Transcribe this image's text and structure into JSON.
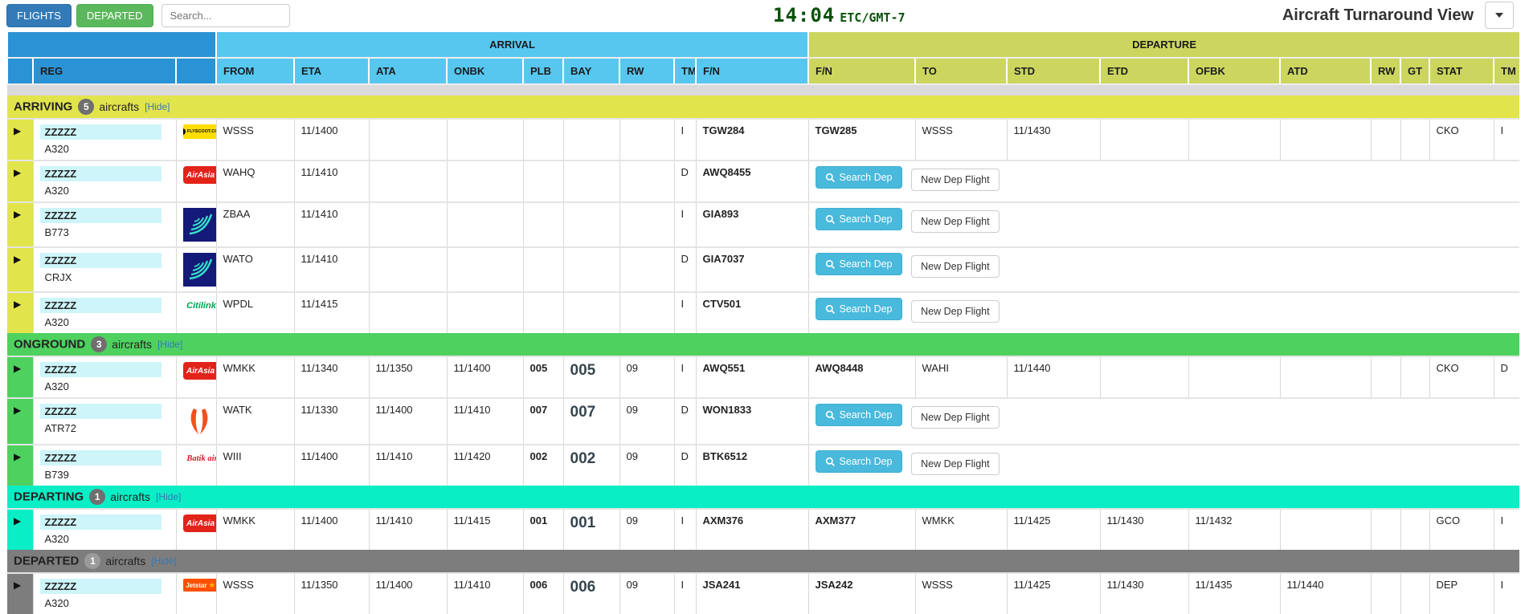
{
  "toolbar": {
    "flights_label": "FLIGHTS",
    "departed_label": "DEPARTED",
    "search_placeholder": "Search...",
    "clock_time": "14:04",
    "clock_tz": "ETC/GMT-7",
    "title": "Aircraft Turnaround View"
  },
  "table": {
    "group_arrival": "ARRIVAL",
    "group_departure": "DEPARTURE",
    "reg_col": "REG",
    "arr_cols": [
      "FROM",
      "ETA",
      "ATA",
      "ONBK",
      "PLB",
      "BAY",
      "RW",
      "TM",
      "F/N"
    ],
    "dep_cols": [
      "F/N",
      "TO",
      "STD",
      "ETD",
      "OFBK",
      "ATD",
      "RW",
      "GT",
      "STAT",
      "TM"
    ]
  },
  "buttons": {
    "search_dep": "Search Dep",
    "new_dep_flight": "New Dep Flight"
  },
  "logos": {
    "flyscoot": "FLYSCOOT.COM",
    "airasia": "AirAsia",
    "citilink": "Citilink",
    "batik": "Batik air",
    "jetstar": "Jetstar"
  },
  "sections": [
    {
      "name": "ARRIVING",
      "count": "5",
      "suffix": "aircrafts",
      "hide": "[Hide]",
      "rows": [
        {
          "reg": "ZZZZZ",
          "type": "A320",
          "from": "WSSS",
          "eta": "11/1400",
          "ata": "",
          "onbk": "",
          "plb": "",
          "bay": "",
          "rw": "",
          "tm": "I",
          "fn": "TGW284",
          "dep": {
            "fn": "TGW285",
            "to": "WSSS",
            "std": "11/1430",
            "etd": "",
            "ofbk": "",
            "atd": "",
            "rw": "",
            "gt": "",
            "stat": "CKO",
            "tm": "I"
          }
        },
        {
          "reg": "ZZZZZ",
          "type": "A320",
          "from": "WAHQ",
          "eta": "11/1410",
          "ata": "",
          "onbk": "",
          "plb": "",
          "bay": "",
          "rw": "",
          "tm": "D",
          "fn": "AWQ8455"
        },
        {
          "reg": "ZZZZZ",
          "type": "B773",
          "from": "ZBAA",
          "eta": "11/1410",
          "ata": "",
          "onbk": "",
          "plb": "",
          "bay": "",
          "rw": "",
          "tm": "I",
          "fn": "GIA893"
        },
        {
          "reg": "ZZZZZ",
          "type": "CRJX",
          "from": "WATO",
          "eta": "11/1410",
          "ata": "",
          "onbk": "",
          "plb": "",
          "bay": "",
          "rw": "",
          "tm": "D",
          "fn": "GIA7037"
        },
        {
          "reg": "ZZZZZ",
          "type": "A320",
          "from": "WPDL",
          "eta": "11/1415",
          "ata": "",
          "onbk": "",
          "plb": "",
          "bay": "",
          "rw": "",
          "tm": "I",
          "fn": "CTV501"
        }
      ]
    },
    {
      "name": "ONGROUND",
      "count": "3",
      "suffix": "aircrafts",
      "hide": "[Hide]",
      "rows": [
        {
          "reg": "ZZZZZ",
          "type": "A320",
          "from": "WMKK",
          "eta": "11/1340",
          "ata": "11/1350",
          "onbk": "11/1400",
          "plb": "005",
          "bay": "005",
          "rw": "09",
          "tm": "I",
          "fn": "AWQ551",
          "dep": {
            "fn": "AWQ8448",
            "to": "WAHI",
            "std": "11/1440",
            "etd": "",
            "ofbk": "",
            "atd": "",
            "rw": "",
            "gt": "",
            "stat": "CKO",
            "tm": "D"
          }
        },
        {
          "reg": "ZZZZZ",
          "type": "ATR72",
          "from": "WATK",
          "eta": "11/1330",
          "ata": "11/1400",
          "onbk": "11/1410",
          "plb": "007",
          "bay": "007",
          "rw": "09",
          "tm": "D",
          "fn": "WON1833"
        },
        {
          "reg": "ZZZZZ",
          "type": "B739",
          "from": "WIII",
          "eta": "11/1400",
          "ata": "11/1410",
          "onbk": "11/1420",
          "plb": "002",
          "bay": "002",
          "rw": "09",
          "tm": "D",
          "fn": "BTK6512"
        }
      ]
    },
    {
      "name": "DEPARTING",
      "count": "1",
      "suffix": "aircrafts",
      "hide": "[Hide]",
      "rows": [
        {
          "reg": "ZZZZZ",
          "type": "A320",
          "from": "WMKK",
          "eta": "11/1400",
          "ata": "11/1410",
          "onbk": "11/1415",
          "plb": "001",
          "bay": "001",
          "rw": "09",
          "tm": "I",
          "fn": "AXM376",
          "dep": {
            "fn": "AXM377",
            "to": "WMKK",
            "std": "11/1425",
            "etd": "11/1430",
            "ofbk": "11/1432",
            "atd": "",
            "rw": "",
            "gt": "",
            "stat": "GCO",
            "tm": "I"
          }
        }
      ]
    },
    {
      "name": "DEPARTED",
      "count": "1",
      "suffix": "aircrafts",
      "hide": "[Hide]",
      "rows": [
        {
          "reg": "ZZZZZ",
          "type": "A320",
          "from": "WSSS",
          "eta": "11/1350",
          "ata": "11/1400",
          "onbk": "11/1410",
          "plb": "006",
          "bay": "006",
          "rw": "09",
          "tm": "I",
          "fn": "JSA241",
          "dep": {
            "fn": "JSA242",
            "to": "WSSS",
            "std": "11/1425",
            "etd": "11/1430",
            "ofbk": "11/1435",
            "atd": "11/1440",
            "rw": "",
            "gt": "",
            "stat": "DEP",
            "tm": "I"
          }
        }
      ]
    }
  ],
  "colors": {
    "header_blue": "#2a93d5",
    "arrival_blue": "#58c7f0",
    "departure_olive": "#ccd65f",
    "arriving_band": "#e2e44b",
    "onground_band": "#4ed15f",
    "departing_band": "#0aeec6",
    "departed_band": "#7d7d7d",
    "cyan_cell": "#e2f9fc",
    "reg_highlight": "#cdf5fa",
    "primary_btn": "#337ab7",
    "success_btn": "#5cb85c",
    "searchdep_btn": "#49b9dc",
    "clock_green": "#0a520a",
    "hide_link": "#337ab7"
  }
}
